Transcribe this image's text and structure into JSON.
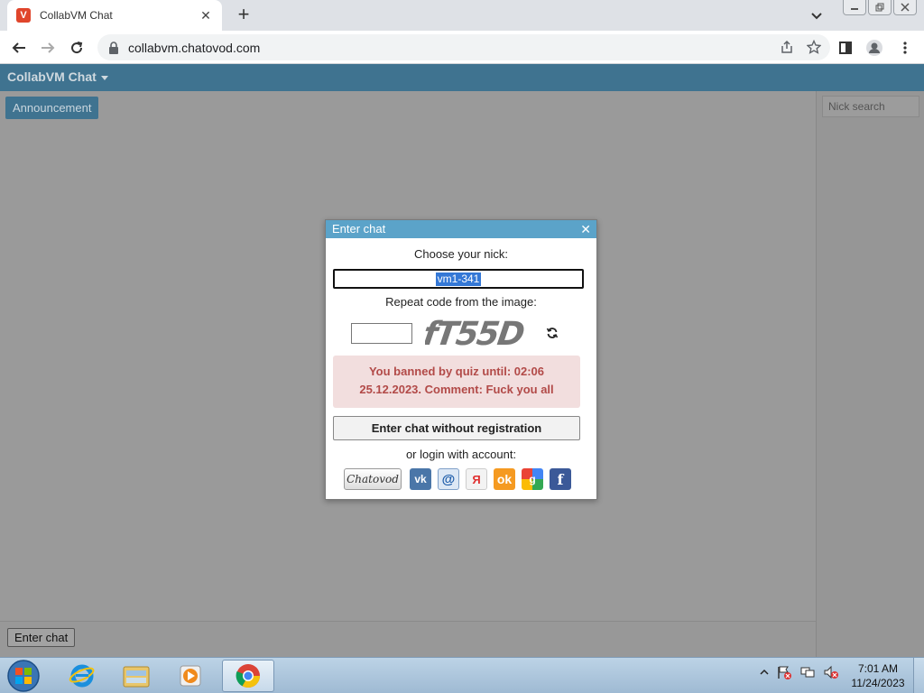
{
  "browser": {
    "tab_title": "CollabVM Chat",
    "url": "collabvm.chatovod.com"
  },
  "app": {
    "title": "CollabVM Chat",
    "announcement_label": "Announcement",
    "nick_search_placeholder": "Nick search",
    "enter_chat_label": "Enter chat"
  },
  "dialog": {
    "title": "Enter chat",
    "nick_label": "Choose your nick:",
    "nick_value": "vm1-341",
    "code_label": "Repeat code from the image:",
    "captcha_text": "fT55D",
    "error_line1": "You banned by quiz until: 02:06",
    "error_line2": "25.12.2023. Comment: Fuck you all",
    "register_button": "Enter chat without registration",
    "login_label": "or login with account:",
    "providers": [
      "Chatovod",
      "VK",
      "Mail.ru",
      "Yandex",
      "Odnoklassniki",
      "Google",
      "Facebook"
    ],
    "chatovod_label": "Chatovod"
  },
  "taskbar": {
    "time": "7:01 AM",
    "date": "11/24/2023"
  },
  "colors": {
    "appbar": "#3f7390",
    "dialog_header": "#5ba3c9",
    "error_bg": "#f2dede",
    "error_text": "#b24a48",
    "overlay": "#9a9a9a"
  }
}
